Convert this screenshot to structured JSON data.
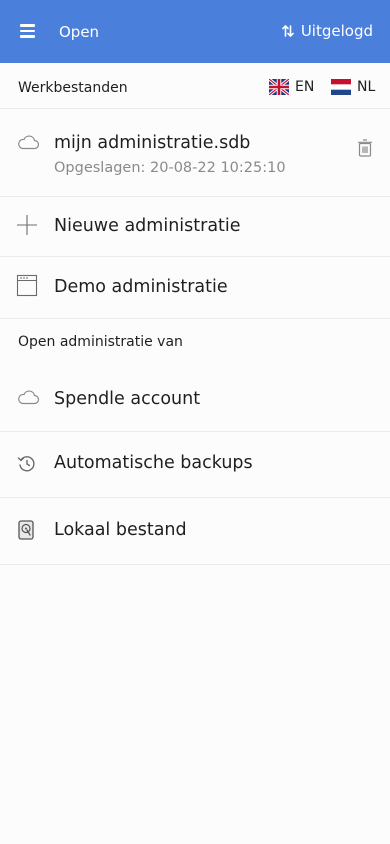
{
  "header": {
    "title": "Open",
    "logout_label": "Uitgelogd",
    "background": "#4a7fdc"
  },
  "workfiles": {
    "heading": "Werkbestanden",
    "languages": [
      {
        "code": "EN",
        "flag": "uk-flag-icon"
      },
      {
        "code": "NL",
        "flag": "nl-flag-icon"
      }
    ],
    "file": {
      "name": "mijn administratie.sdb",
      "saved": "Opgeslagen: 20-08-22 10:25:10",
      "icon": "cloud-icon",
      "delete_icon": "trash-icon"
    },
    "new_label": "Nieuwe administratie",
    "demo_label": "Demo administratie"
  },
  "open_from": {
    "heading": "Open administratie van",
    "items": [
      {
        "label": "Spendle account",
        "icon": "cloud-icon"
      },
      {
        "label": "Automatische backups",
        "icon": "history-icon"
      },
      {
        "label": "Lokaal bestand",
        "icon": "hard-drive-icon"
      }
    ]
  }
}
